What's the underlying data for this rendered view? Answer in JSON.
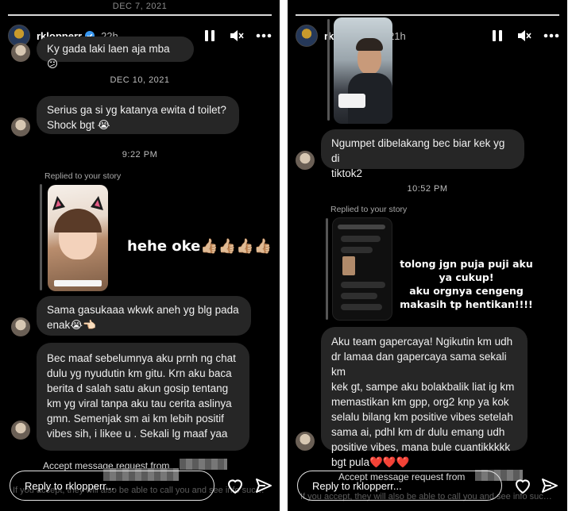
{
  "left": {
    "date_top": "DEC 7, 2021",
    "username": "rklopperr",
    "time_ago": "22h",
    "msg1": "Ky gada laki laen aja mba 😕",
    "date2": "DEC 10, 2021",
    "msg2_line1": "Serius ga si yg katanya ewita d toilet?",
    "msg2_line2": "Shock bgt 😭",
    "time_sep": "9:22 PM",
    "replied_label": "Replied to your story",
    "story_caption": "hehe oke👍🏼👍🏼👍🏼👍🏼",
    "msg3_line1": "Sama gasukaaa wkwk aneh yg blg pada",
    "msg3_line2": "enak😭👈🏻",
    "msg4_lines": [
      "Bec maaf sebelumnya aku prnh ng chat",
      "dulu yg nyudutin km gitu. Krn aku baca",
      "berita d salah satu akun gosip tentang",
      "km yg viral tanpa aku tau cerita aslinya",
      "gmn. Semenjak sm ai km lebih positif",
      "vibes sih, i likee u . Sekali lg maaf yaa"
    ],
    "accept_text": "Accept message request from",
    "faint_text": "If you accept, they will also be able to call you and see info such as your activity status and when you've read messages.",
    "reply_placeholder": "Reply to rklopperr..."
  },
  "right": {
    "username": "rklopperr",
    "time_ago": "21h",
    "msg1_line1": "Ngumpet dibelakang bec biar kek yg di",
    "msg1_line2": "tiktok2",
    "time_sep": "10:52 PM",
    "replied_label": "Replied to your story",
    "overlay_lines": [
      "tolong jgn puja puji aku",
      "ya cukup!",
      "aku orgnya cengeng",
      "makasih tp hentikan!!!!"
    ],
    "msg2_lines": [
      "Aku team gapercaya! Ngikutin km udh",
      "dr lamaa dan gapercaya sama sekali km",
      "kek gt, sampe aku bolakbalik liat ig km",
      "memastikan km gpp, org2 knp ya kok",
      "selalu bilang km positive vibes setelah",
      "sama ai, pdhl km dr dulu emang udh",
      "positive vibes, mana bule cuantikkkkk",
      "bgt pula❤️❤️❤️"
    ],
    "accept_text": "Accept message request from",
    "faint_text": "If you accept, they will also be able to call you and see info such as your activity status and when you've read messages.",
    "reply_placeholder": "Reply to rklopperr..."
  },
  "colors": {
    "background": "#000000",
    "bubble": "#262626",
    "separator_gap": "#ffffff"
  },
  "icons": [
    "verified-badge-icon",
    "pause-icon",
    "mute-icon",
    "more-icon",
    "heart-icon",
    "send-icon"
  ]
}
